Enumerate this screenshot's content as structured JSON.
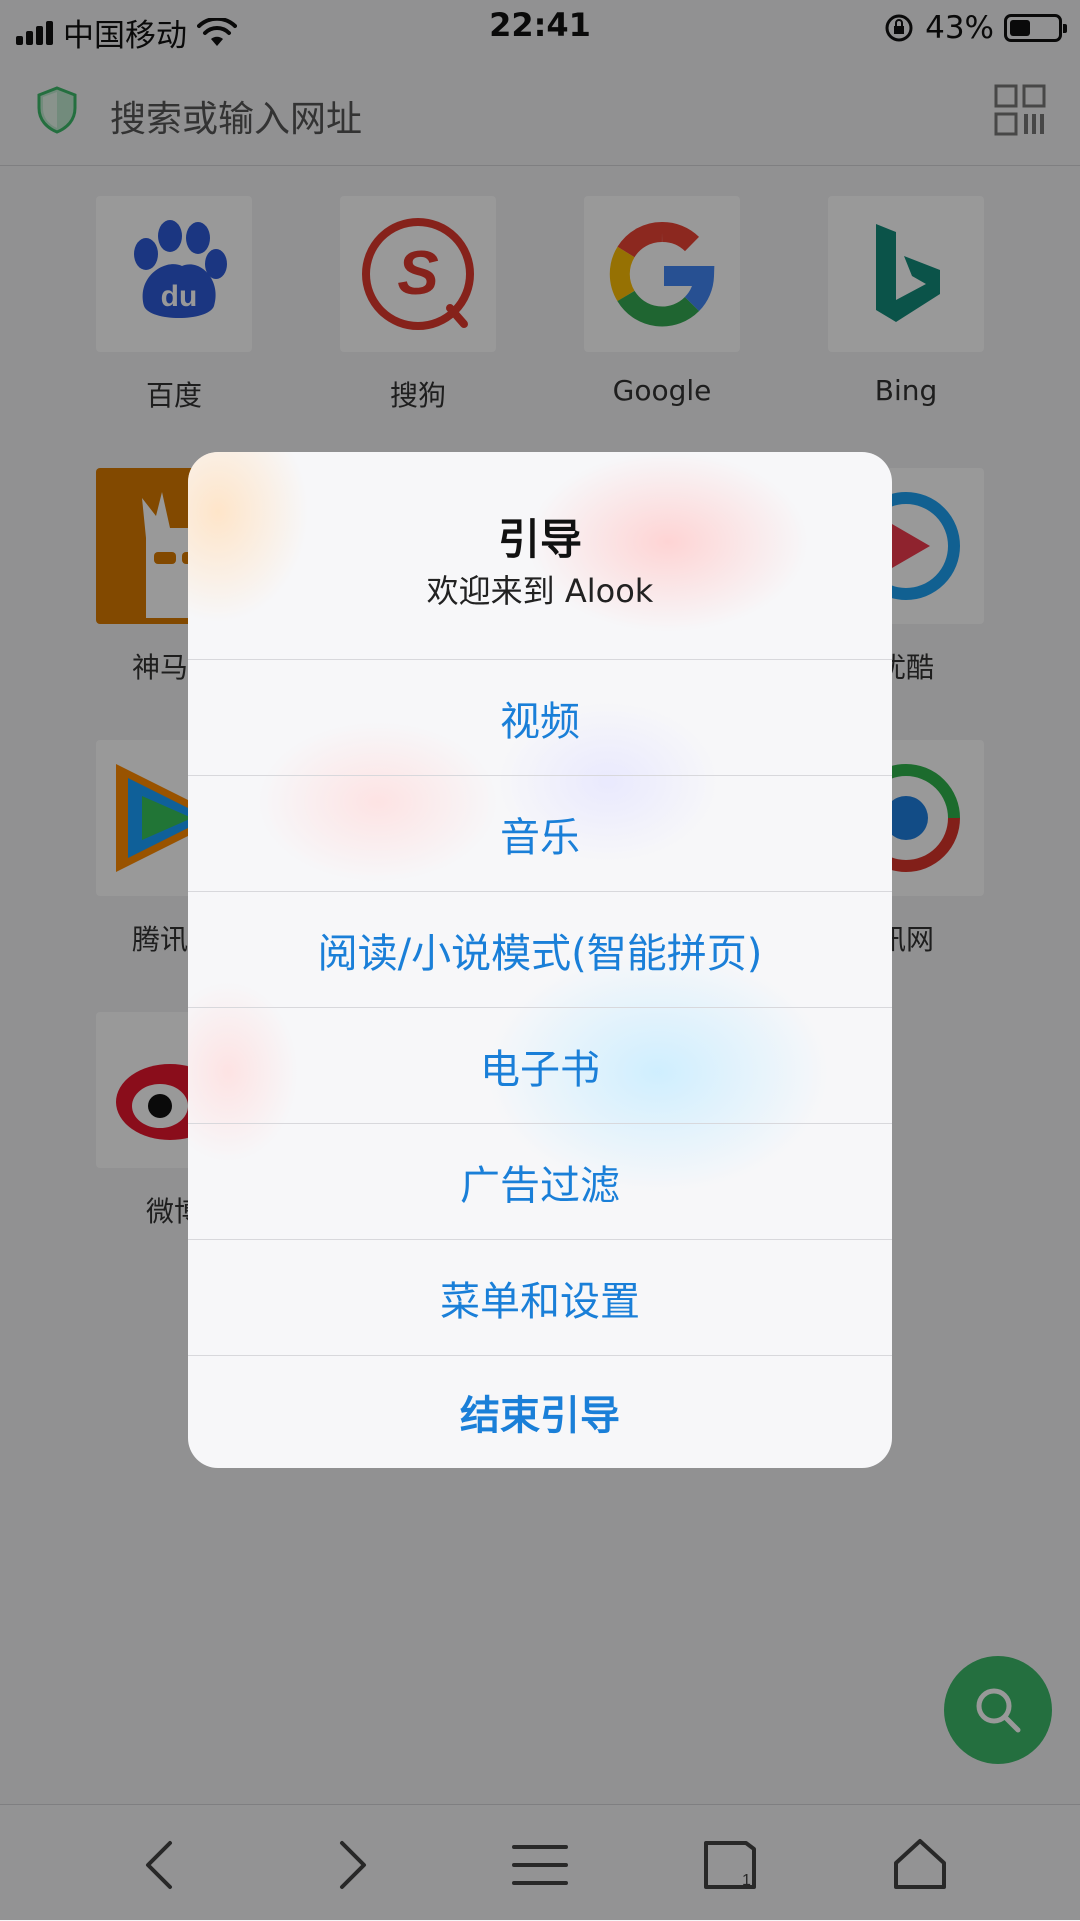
{
  "status": {
    "carrier": "中国移动",
    "time": "22:41",
    "battery_text": "43%",
    "battery_level": 0.43
  },
  "search": {
    "placeholder": "搜索或输入网址"
  },
  "shortcuts": [
    {
      "label": "百度",
      "icon": "baidu-icon"
    },
    {
      "label": "搜狗",
      "icon": "sogou-icon"
    },
    {
      "label": "Google",
      "icon": "google-icon"
    },
    {
      "label": "Bing",
      "icon": "bing-icon"
    },
    {
      "label": "神马搜",
      "icon": "shenma-icon"
    },
    {
      "label": "优酷",
      "icon": "youku-icon"
    },
    {
      "label": "腾讯视",
      "icon": "tencent-video-icon"
    },
    {
      "label": "讯网",
      "icon": "tencent-news-icon"
    },
    {
      "label": "微博",
      "icon": "weibo-icon"
    }
  ],
  "dialog": {
    "title": "引导",
    "subtitle": "欢迎来到 Alook",
    "items": [
      "视频",
      "音乐",
      "阅读/小说模式(智能拼页)",
      "电子书",
      "广告过滤",
      "菜单和设置",
      "结束引导"
    ]
  },
  "colors": {
    "accent_blue": "#1a7fd8",
    "fab_green": "#3cb96a"
  }
}
